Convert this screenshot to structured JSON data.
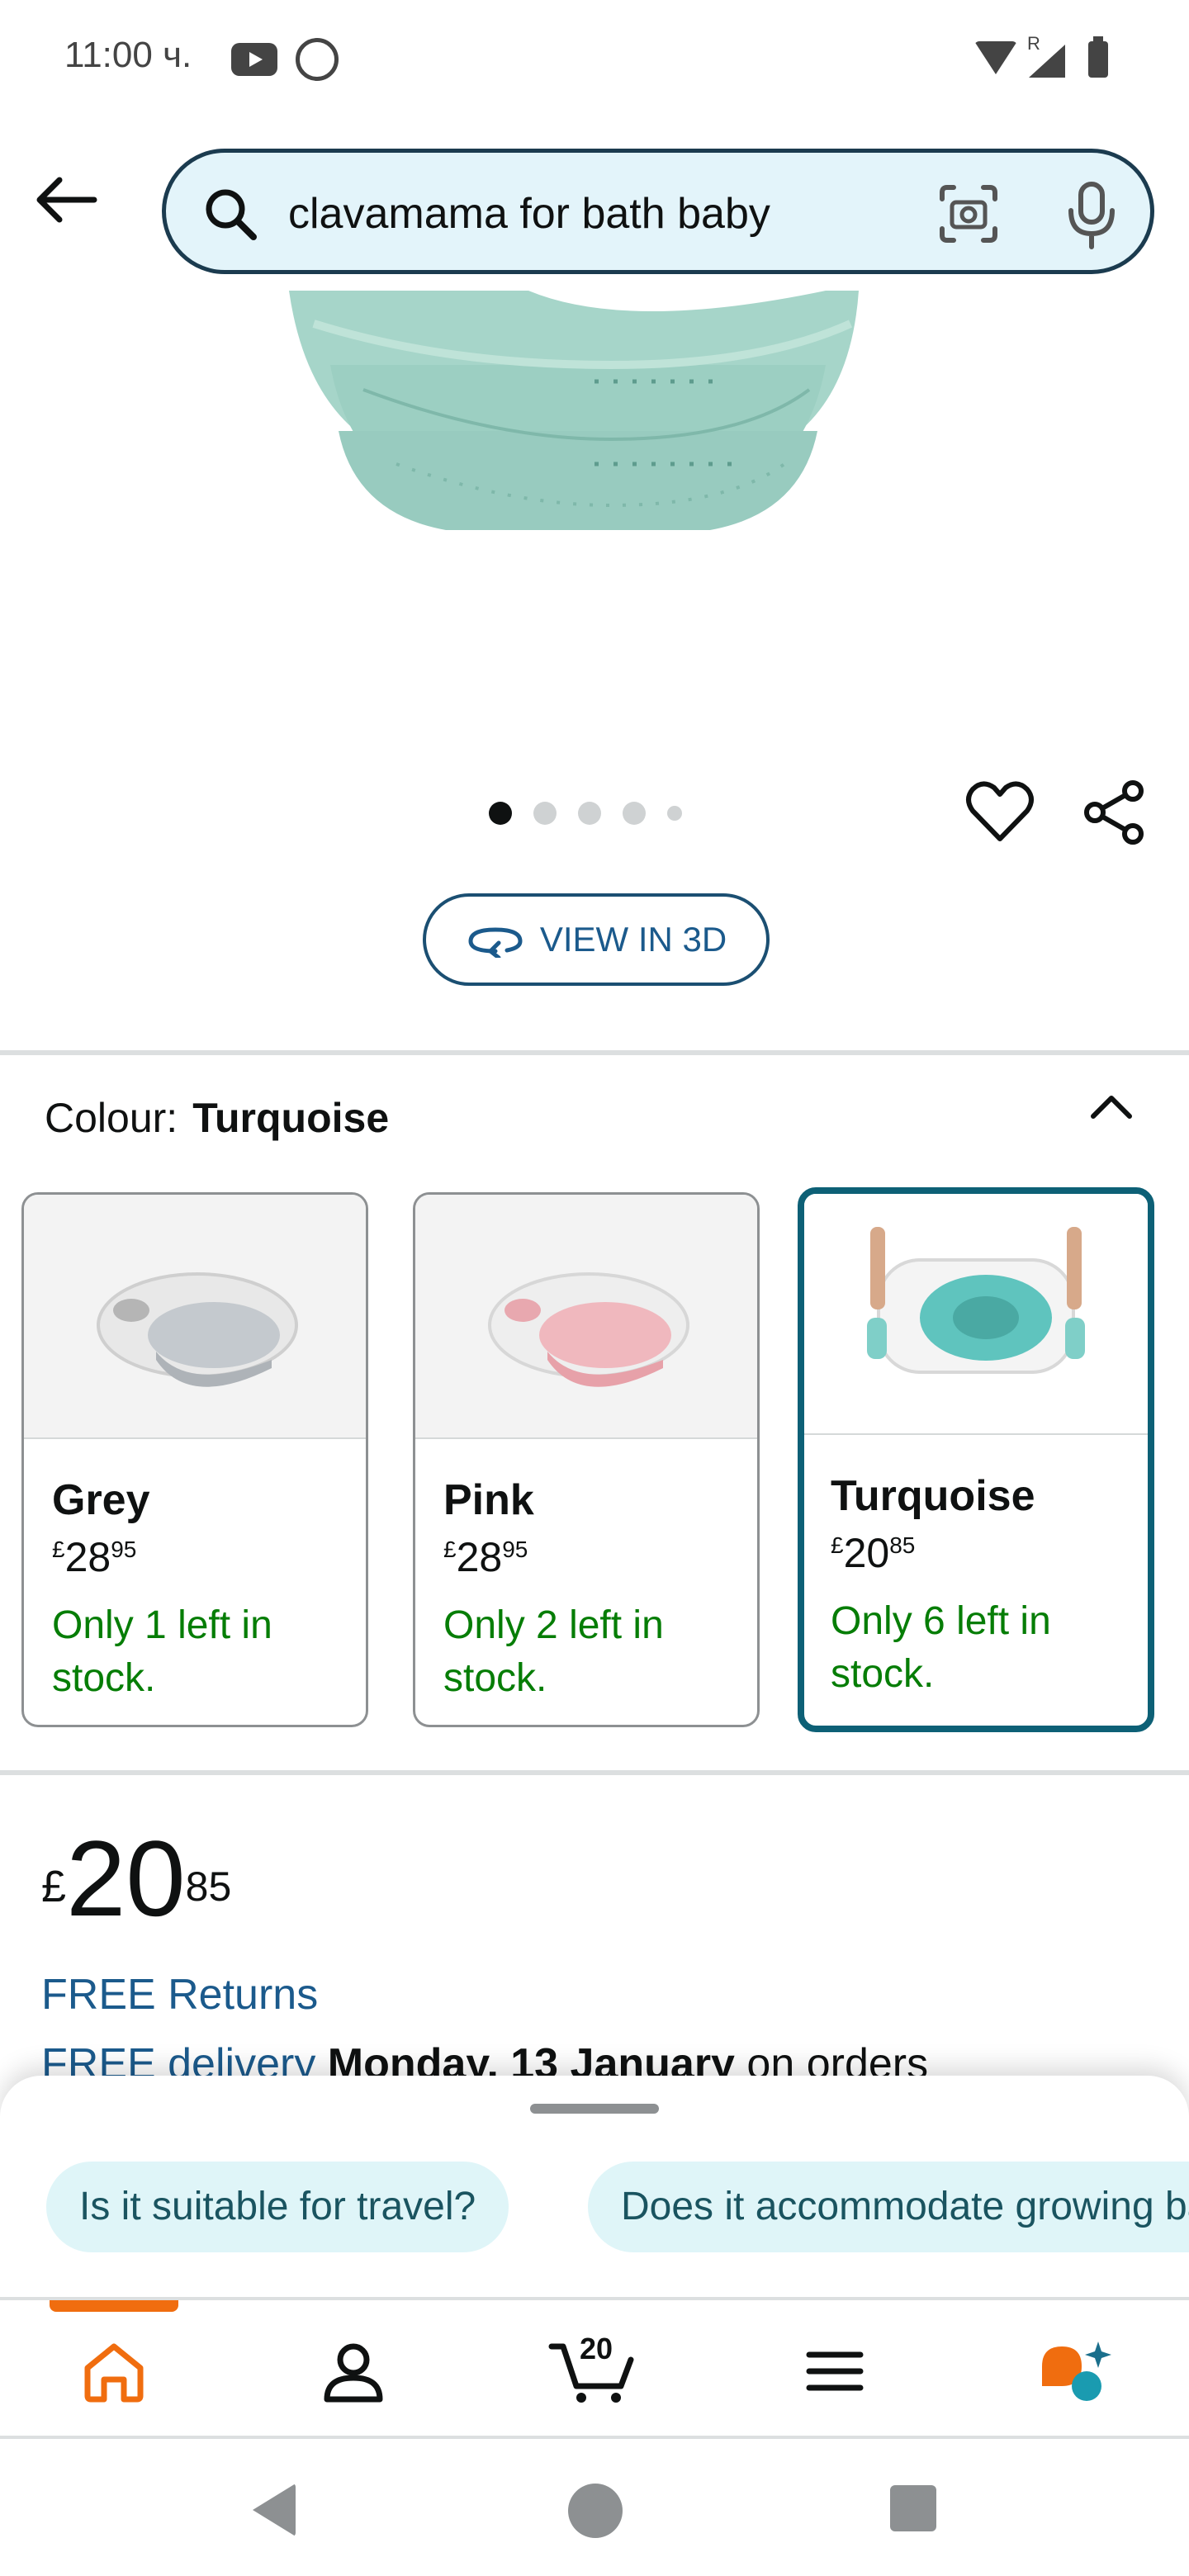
{
  "status_bar": {
    "time": "11:00 ч.",
    "network_label": "R"
  },
  "search": {
    "query": "clavamama for bath baby"
  },
  "product": {
    "view_3d_label": "VIEW IN 3D",
    "carousel_dot_count": 5,
    "carousel_active_index": 0
  },
  "colour": {
    "label": "Colour:",
    "selected": "Turquoise",
    "options": [
      {
        "name": "Grey",
        "price_symbol": "£",
        "price_whole": "28",
        "price_fraction": "95",
        "stock": "Only 1 left in stock.",
        "swatch_color": "#c4c9ce"
      },
      {
        "name": "Pink",
        "price_symbol": "£",
        "price_whole": "28",
        "price_fraction": "95",
        "stock": "Only 2 left in stock.",
        "swatch_color": "#f0b8be"
      },
      {
        "name": "Turquoise",
        "price_symbol": "£",
        "price_whole": "20",
        "price_fraction": "85",
        "stock": "Only 6 left in stock.",
        "swatch_color": "#5fc4be"
      }
    ]
  },
  "price": {
    "symbol": "£",
    "whole": "20",
    "fraction": "85"
  },
  "delivery": {
    "free_returns": "FREE Returns",
    "free_delivery_link": "FREE delivery",
    "date": "Monday, 13 January",
    "suffix": " on orders"
  },
  "suggestions": {
    "chips": [
      "Is it suitable for travel?",
      "Does it accommodate growing babies?"
    ]
  },
  "bottom_nav": {
    "cart_count": "20"
  },
  "colors": {
    "accent_orange": "#f06d0f",
    "link_blue": "#1b5a8c",
    "stock_green": "#067d06",
    "selected_border": "#0d6076",
    "search_bg": "#e3f4fa"
  }
}
